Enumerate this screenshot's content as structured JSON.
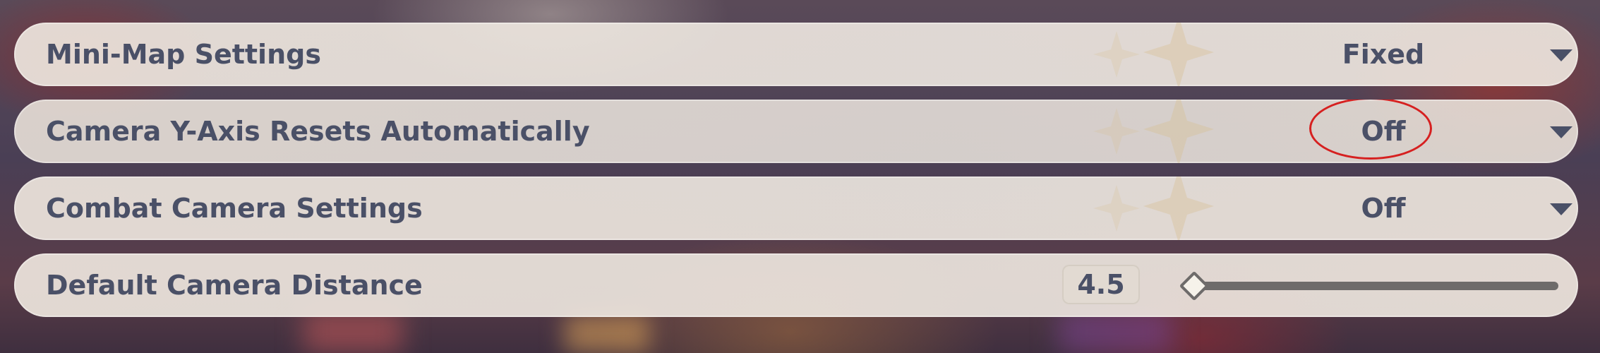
{
  "settings": [
    {
      "label": "Mini-Map Settings",
      "control": "dropdown",
      "value": "Fixed"
    },
    {
      "label": "Camera Y-Axis Resets Automatically",
      "control": "dropdown",
      "value": "Off"
    },
    {
      "label": "Combat Camera Settings",
      "control": "dropdown",
      "value": "Off"
    },
    {
      "label": "Default Camera Distance",
      "control": "slider",
      "value": "4.5",
      "slider_fraction": 0.0
    }
  ],
  "icons": {
    "dropdown": "chevron-down-icon",
    "decoration": "sparkle-star-icon"
  },
  "colors": {
    "text": "#4a5067",
    "row_background": "#ece4dc",
    "annotation": "#d62020",
    "slider_track": "#6e6b6a"
  }
}
